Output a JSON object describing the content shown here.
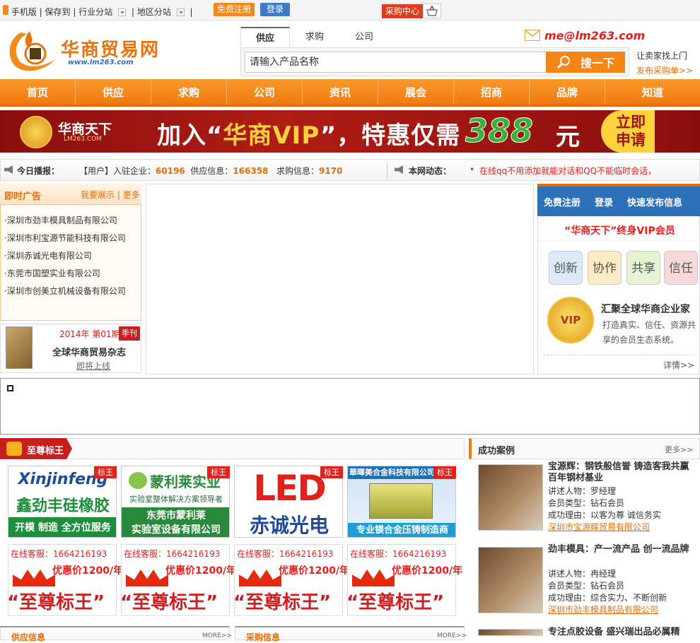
{
  "topbar": {
    "mobile": "手机版",
    "save": "保存到",
    "industry": "行业分站",
    "region": "地区分站",
    "sep": "|",
    "register": "免费注册",
    "login": "登录",
    "buy_center": "采购中心"
  },
  "header": {
    "logo_name": "华商贸易网",
    "logo_url": "www.lm263.com",
    "tabs": [
      "供应",
      "求购",
      "公司"
    ],
    "email": "me@lm263.com",
    "search_placeholder": "请输入产品名称",
    "search_button": "搜一下",
    "seller_link": "让卖家找上门",
    "post_buy": "发布采购单>>"
  },
  "nav": [
    "首页",
    "供应",
    "求购",
    "公司",
    "资讯",
    "展会",
    "招商",
    "品牌",
    "知道"
  ],
  "banner": {
    "brand": "华商天下",
    "brand_url": "LM263.COM",
    "text_a": "加入“",
    "text_b": "华商VIP",
    "text_c": "”，特惠仅需",
    "price": "388",
    "unit": "元",
    "apply": "立即申请"
  },
  "ticker": {
    "today_label": "今日播报：",
    "user_label": "【用户】入驻企业：",
    "companies": "60196",
    "supply_label": "供应信息：",
    "supply": "166358",
    "buy_label": "求购信息：",
    "buy": "9170",
    "news_label": "本网动态：",
    "news": "在线qq不用添加就能对话和QQ不能临时会话，"
  },
  "ads": {
    "title": "即时广告",
    "more": "我要展示 | 更多",
    "items": [
      "·深圳市劲丰模具制品有限公司",
      "·深圳市利宝源节能科技有限公司",
      "·深圳赤诚光电有限公司",
      "·东莞市国塑实业有限公司",
      "·深圳市创美立机械设备有限公司"
    ]
  },
  "magazine": {
    "issue": "2014年 第01期",
    "tag": "季刊",
    "name": "全球华商贸易杂志",
    "status": "即将上线"
  },
  "vip_panel": {
    "links": [
      "免费注册",
      "登录",
      "快速发布信息"
    ],
    "title": "“华商天下”终身VIP会员",
    "pills": [
      "创新",
      "协作",
      "共享",
      "信任"
    ],
    "seal": "VIP",
    "headline": "汇聚全球华商企业家",
    "desc": "打造真实、信任、资源共享的会员生态系统。",
    "more": "详情>>"
  },
  "zhizun": {
    "title": "至尊标王",
    "tag": "标王",
    "cards": [
      {
        "l1": "Xinjinfeng",
        "l2": "鑫劲丰硅橡胶",
        "l3": "开模  制造 全方位服务"
      },
      {
        "l1": "蒙利莱实业",
        "l2": "实验室整体解决方案领导者",
        "l3": "东莞市蒙利莱",
        "l4": "实验室设备有限公司"
      },
      {
        "l1": "LED",
        "l2": "赤诚光电"
      },
      {
        "l1": "華暉美合金科技有限公司",
        "l3": "专业镁合金压铸制造商"
      }
    ],
    "promo_cs": "在线客服：1664216193",
    "promo_price": "优惠价1200/年",
    "promo_big": "“至尊标王”"
  },
  "success": {
    "title": "成功案例",
    "more": "更多>>",
    "cases": [
      {
        "headline": "宝源辉：钢铁般信誉 铸造客我共赢百年钢材基业",
        "speaker": "讲述人物：罗经理",
        "member": "会员类型：钻石会员",
        "reason": "成功理由：以客为尊 诚信务实",
        "company": "深圳市宝源辉贸易有限公司"
      },
      {
        "headline": "劲丰模具：产一流产品 创一流品牌",
        "speaker": "讲述人物：冉经理",
        "member": "会员类型：钻石会员",
        "reason": "成功理由：综合实力、不断创新",
        "company": "深圳市劲丰模具制品有限公司"
      },
      {
        "headline": "专注点胶设备 盛兴瑞出品必属精"
      }
    ]
  },
  "bottom": {
    "supply": "供应信息",
    "buy": "采购信息",
    "more": "MORE>>"
  },
  "colors": {
    "orange": "#f07a10",
    "red": "#c81e1e",
    "blue": "#2d71b9"
  }
}
